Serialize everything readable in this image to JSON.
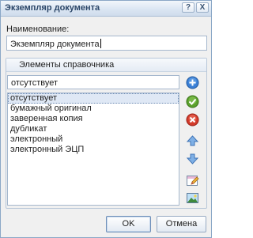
{
  "window": {
    "title": "Экземпляр документа",
    "help_glyph": "?",
    "close_glyph": "X"
  },
  "name_field": {
    "label": "Наименование:",
    "value": "Экземпляр документа"
  },
  "group": {
    "title": "Элементы справочника",
    "item_input_value": "отсутствует",
    "items": [
      "отсутствует",
      "бумажный оригинал",
      "заверенная копия",
      "дубликат",
      "электронный",
      "электронный ЭЦП"
    ],
    "selected_index": 0,
    "side_buttons": [
      {
        "icon": "add-icon",
        "color": "#3a7fd5"
      },
      {
        "icon": "apply-icon",
        "color": "#5aa02c"
      },
      {
        "icon": "delete-icon",
        "color": "#d23a2a"
      },
      {
        "icon": "move-up-icon",
        "color": "#5b8fd0"
      },
      {
        "icon": "move-down-icon",
        "color": "#5b8fd0"
      },
      {
        "icon": "edit-icon",
        "color": "#c05a9a"
      },
      {
        "icon": "image-icon",
        "color": "#3f8a3a"
      }
    ]
  },
  "footer": {
    "ok_label": "OK",
    "cancel_label": "Отмена"
  }
}
